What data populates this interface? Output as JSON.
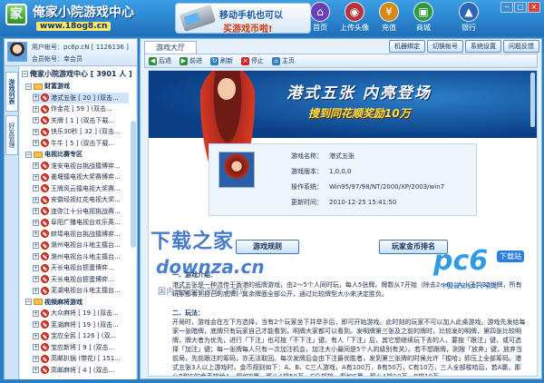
{
  "app": {
    "title": "俺家小院游戏中心",
    "url": "www.18og8.cn",
    "logo_glyph": "家"
  },
  "promo": {
    "line1": "移动手机也可以",
    "line2": "买游戏币啦!"
  },
  "nav": [
    {
      "label": "首页",
      "icon": "home-icon",
      "color": "#6a3fb8",
      "glyph": "⌂"
    },
    {
      "label": "上传头像",
      "icon": "camera-icon",
      "color": "#b8323a",
      "glyph": "◉"
    },
    {
      "label": "充值",
      "icon": "coin-icon",
      "color": "#d48a12",
      "glyph": "¥"
    },
    {
      "label": "商城",
      "icon": "store-icon",
      "color": "#2f9a3c",
      "glyph": "▣"
    },
    {
      "label": "银行",
      "icon": "bank-icon",
      "color": "#2b66b8",
      "glyph": "▲"
    }
  ],
  "window": {
    "min": "─",
    "max": "□",
    "close": "×"
  },
  "user": {
    "account_label": "用户帐号：",
    "account_value": "pc6p.cN",
    "account_id": "[ 1126136 ]",
    "nickname_label": "会员帐号：",
    "nickname_value": "幸会员"
  },
  "vtabs": [
    "游戏列表",
    "好友管理"
  ],
  "tree": {
    "root": "俺家小院游戏中心  [ 3901 人 ]",
    "rows": [
      {
        "kind": "cat",
        "text": "财富游戏"
      },
      {
        "kind": "item",
        "text": "港式五张 [ 20 ]  (双击...",
        "sel": true
      },
      {
        "kind": "item",
        "text": "炸金花 [ 59 ]  (双击..."
      },
      {
        "kind": "item",
        "text": "关牌 [ 1 ]  (双击下载..."
      },
      {
        "kind": "item",
        "text": "快乐30秒 [ 32 ]  (双击..."
      },
      {
        "kind": "item",
        "text": "牛牛 [ 5 ]  (双击下载..."
      },
      {
        "kind": "cat",
        "text": "电视比赛专区"
      },
      {
        "kind": "item",
        "text": "淮安电视台挑战擂博弈..."
      },
      {
        "kind": "item",
        "text": "姜堰擂电视大奖赛博弈..."
      },
      {
        "kind": "item",
        "text": "王牌风云擂电视大奖赛..."
      },
      {
        "kind": "item",
        "text": "安徽经视红花电视大奖..."
      },
      {
        "kind": "item",
        "text": "连弥江十分电视挑战赛..."
      },
      {
        "kind": "item",
        "text": "阜阳广播电视台欢乐英..."
      },
      {
        "kind": "item",
        "text": "蚌埠电视台挑战擂博弈..."
      },
      {
        "kind": "item",
        "text": "滁州电视台斗地主擂台..."
      },
      {
        "kind": "item",
        "text": "滁州电视台斗地主擂台..."
      },
      {
        "kind": "item",
        "text": "天长电视台掼蛋博弈..."
      },
      {
        "kind": "item",
        "text": "天长电视台掼蛋博弈..."
      },
      {
        "kind": "item",
        "text": "芜湖电视台斗地主擂台..."
      },
      {
        "kind": "cat",
        "text": "视频麻将游戏"
      },
      {
        "kind": "item",
        "text": "大众麻将 [ 19 ]  (双击..."
      },
      {
        "kind": "item",
        "text": "芜湖麻将 [ 19 ]  (双击..."
      },
      {
        "kind": "item",
        "text": "宝应全民 [ 126 ]  (双..."
      },
      {
        "kind": "item",
        "text": "宝应新将 [ 9 ]  (双击..."
      },
      {
        "kind": "item",
        "text": "高邮扒锅 (带花) [ 151..."
      },
      {
        "kind": "item",
        "text": "高邮麻将 [ 4 ]  (双击..."
      }
    ]
  },
  "content": {
    "tab_label": "游戏大厅",
    "func_buttons": [
      "机器绑定",
      "切换帐号",
      "系统设置",
      "问题反馈"
    ],
    "toolbar": [
      {
        "label": "后退",
        "icon": "back-icon",
        "glyph": "◀",
        "color": "#2f8a3c"
      },
      {
        "label": "前进",
        "icon": "forward-icon",
        "glyph": "▶",
        "color": "#2f8a3c"
      },
      {
        "label": "刷新",
        "icon": "refresh-icon",
        "glyph": "↻",
        "color": "#2f7fc4"
      },
      {
        "label": "停止",
        "icon": "stop-icon",
        "glyph": "×",
        "color": "#cc2a22"
      },
      {
        "label": "主页",
        "icon": "home-icon",
        "glyph": "⌂",
        "color": "#2f7fc4"
      }
    ]
  },
  "hero": {
    "title": "港式五张  内亮登场",
    "subtitle": "搜到同花顺奖励10万"
  },
  "info": {
    "rows": [
      {
        "k": "游戏名称：",
        "v": "港式五张"
      },
      {
        "k": "游戏版本：",
        "v": "1,0,0,0"
      },
      {
        "k": "操作系统：",
        "v": "Win95/97/98/NT/2000/XP/2003/win7"
      },
      {
        "k": "更新时间：",
        "v": "2010-12-25 15:41:50"
      }
    ]
  },
  "buttons": {
    "rules": "游戏规则",
    "ranking": "玩家金币排名"
  },
  "rules": {
    "sec1": "一、游戏介绍：",
    "para1": "港式五张是一种流传于香港的纸牌游戏，由2～5个人同时玩，每人5张牌。牌数从7开始（除去2～6）大小王共32张牌，所有玩家都看到自己的底牌，其余牌面全部公开，通过比较牌型大小来决定胜负。",
    "sec2": "二、玩法：",
    "para2": "开局时，游戏会在左下方选择，当有2个玩家坐下并举手后，即可开始游戏。此时刻的玩家不可以加入此桌游戏。游戏先发给每家一张暗牌，底牌只有玩家自己才能看到，明牌大家都可以看到。发明牌第三张及之前的牌时，比较发的明牌，第四张比较明牌，牌大者为优先，进行「下注」也可按「不下注」键。有人「下注」后，其它想继续玩下去的人，要按「跟注」键，或可选择「加注」键；每一张牌每人只有一次加注机会，加注大小最同是5个人的级别有关）。若不想跟牌，则按「放弃」键，放弃当前局，先前跟注的筹码，亦无法取回。每次发牌后会由下注最优胜者，发到第三张牌的时候允许「梭哈」即压上全部筹码。港式五张3人以上游戏时，金币规则如下：A、B、C三人游戏，A有100万，B有50万，C有10万，三人全部梭哈后，若A赢，那么B和C的金币输给A，假如B赢，那么A输50万，C全部输，假如C赢，那么A输10万，B输10万。"
  },
  "watermark": {
    "cn": "下载之家",
    "en": "downza.cn",
    "sub": "国内最安全的软件下载站",
    "pc6": "pc6",
    "pc6_badge": "下载站",
    "pc6_sub": "中国最安全的下载站"
  }
}
